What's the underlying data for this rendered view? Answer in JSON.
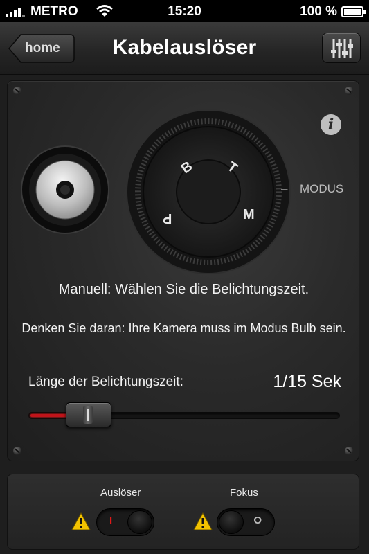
{
  "status_bar": {
    "carrier": "METRO",
    "time": "15:20",
    "battery": "100 %",
    "battery_level": 1.0
  },
  "nav": {
    "back_label": "home",
    "title": "Kabelauslöser",
    "settings_icon": "sliders-icon"
  },
  "dial": {
    "letters": {
      "b": "B",
      "t": "T",
      "p": "P",
      "m": "M"
    },
    "mode_dash": "–",
    "mode_label": "MODUS"
  },
  "info_icon": "i",
  "messages": {
    "manual": "Manuell: Wählen Sie die Belichtungszeit.",
    "reminder": "Denken Sie daran: Ihre Kamera muss im Modus Bulb sein."
  },
  "exposure": {
    "label": "Länge der Belichtungszeit:",
    "value": "1/15 Sek",
    "slider_fraction": 0.14
  },
  "toggles": {
    "shutter": {
      "label": "Auslöser",
      "mark": "I",
      "on": true
    },
    "focus": {
      "label": "Fokus",
      "mark": "O",
      "on": false
    }
  },
  "colors": {
    "accent_red": "#c0141a",
    "warning_yellow": "#f2c200"
  }
}
